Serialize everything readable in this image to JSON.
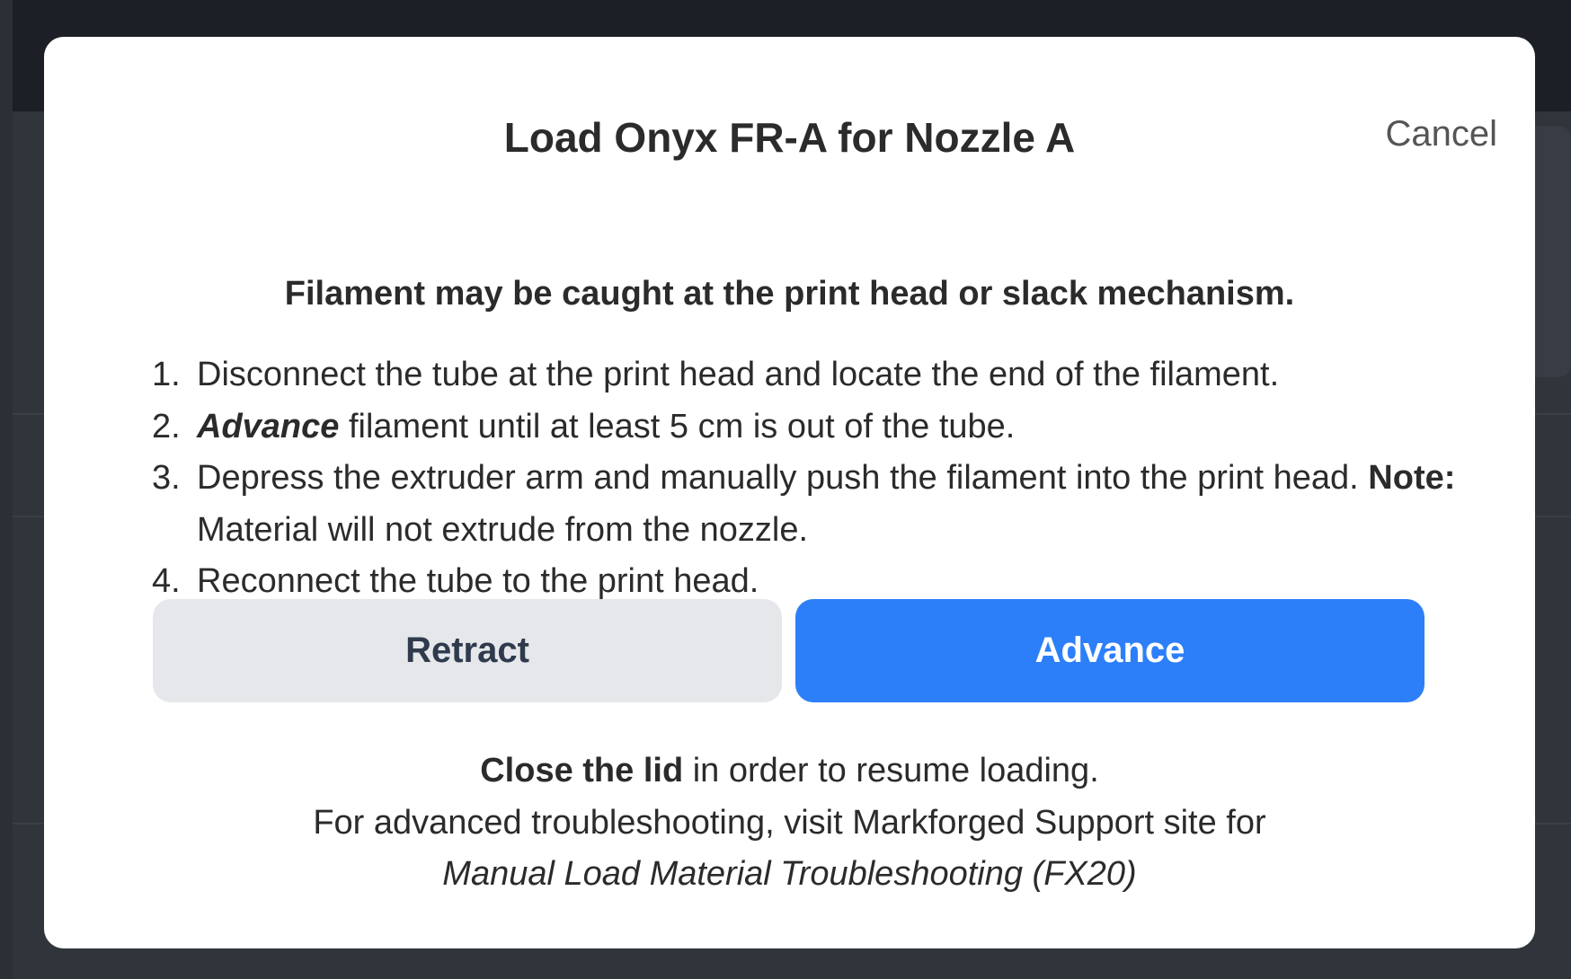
{
  "modal": {
    "title": "Load Onyx FR-A for Nozzle A",
    "cancel_label": "Cancel",
    "warning": "Filament may be caught at the print head or slack mechanism.",
    "steps": [
      {
        "number": "1.",
        "text": "Disconnect the tube at the print head and locate the end of the filament."
      },
      {
        "number": "2.",
        "emphasis": "Advance",
        "text": "filament until at least 5 cm is out of the tube."
      },
      {
        "number": "3.",
        "text": "Depress the extruder arm and manually push the filament into the print head.",
        "note_label": "Note:",
        "note_text": "Material will not extrude from the nozzle."
      },
      {
        "number": "4.",
        "text": "Reconnect the tube to the print head."
      }
    ],
    "buttons": {
      "retract_label": "Retract",
      "advance_label": "Advance"
    },
    "footer": {
      "lid_bold": "Close the lid",
      "lid_rest": "in order to resume loading.",
      "support_text": "For advanced troubleshooting, visit Markforged Support site for",
      "support_link": "Manual Load Material Troubleshooting (FX20)"
    }
  },
  "colors": {
    "advance_button": "#2d7ff9",
    "retract_button": "#e5e7eb",
    "overlay": "#2b2f36",
    "modal_background": "#ffffff"
  }
}
